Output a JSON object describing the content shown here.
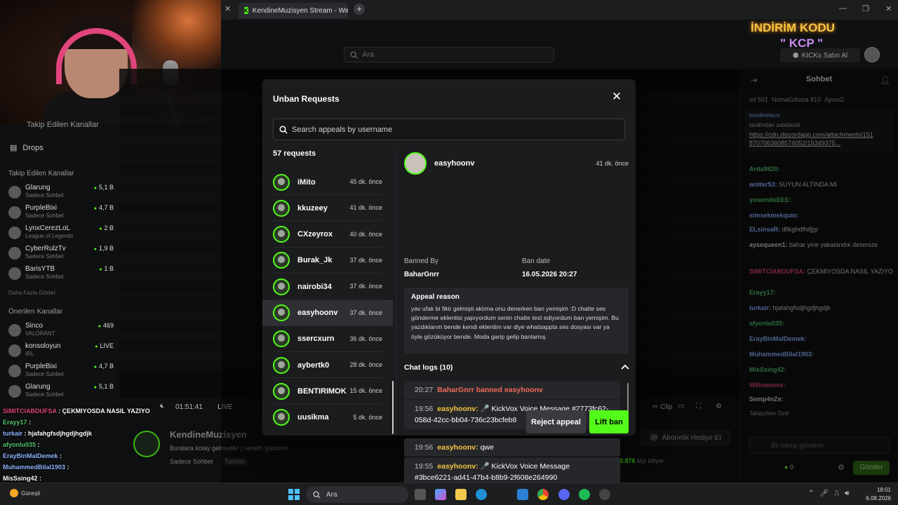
{
  "browser": {
    "tab_title": "KendineMuzisyen Stream - Wa",
    "tab_close": "✕",
    "new_tab": "+",
    "search_placeholder": "Ara"
  },
  "promo": {
    "line1": "İNDİRİM KODU",
    "line2": "\" KCP \"",
    "kicks_label": "KICKs Satın Al"
  },
  "left_sidebar": {
    "following_label": "Takip Edilen Kanallar",
    "drops_label": "Drops",
    "followed_header": "Takip Edilen Kanallar",
    "followed": [
      {
        "name": "Glarung",
        "sub": "Sadece Sohbet",
        "viewers": "5,1 B"
      },
      {
        "name": "PurpleBixi",
        "sub": "Sadece Sohbet",
        "viewers": "4,7 B"
      },
      {
        "name": "LynxCerezLoL",
        "sub": "League of Legends",
        "viewers": "2 B"
      },
      {
        "name": "CyberRulzTv",
        "sub": "Sadece Sohbet",
        "viewers": "1,9 B"
      },
      {
        "name": "BarisYTB",
        "sub": "Sadece Sohbet",
        "viewers": "1 B"
      }
    ],
    "show_more": "Daha Fazla Göster",
    "recommended_header": "Önerilen Kanallar",
    "recommended": [
      {
        "name": "Sinco",
        "sub": "VALORANT",
        "viewers": "469"
      },
      {
        "name": "konsoloyun",
        "sub": "IRL",
        "viewers": "LIVE"
      },
      {
        "name": "PurpleBixi",
        "sub": "Sadece Sohbet",
        "viewers": "4,7 B"
      },
      {
        "name": "Glarung",
        "sub": "Sadece Sohbet",
        "viewers": "5,1 B"
      }
    ]
  },
  "player": {
    "time": "01:51:41",
    "live": "LIVE",
    "clip": "Clip"
  },
  "stream_info": {
    "channel": "KendineMuzisyen",
    "desc": "Buralara kolay gelmedik! | !wraith !pindirim",
    "tags": [
      "Sadece Sohbet",
      "Turkish"
    ],
    "gift_label": "Abonelik Hediye Et",
    "viewers_count": "10.876",
    "viewers_label": "kişi izliyor"
  },
  "chat": {
    "title": "Sohbet",
    "top_gifters": [
      "ml 501",
      "NomaGdusia 810",
      "ApuuG"
    ],
    "pinned_by": "kendinetaco",
    "pinned_from": "tarafından sabitlendi",
    "pinned_link": "https://cdn.discordapp.com/attachments/1518707063608574052/15349375...",
    "messages": [
      {
        "user": "Arda9820:",
        "text": "",
        "color": "#53c56c"
      },
      {
        "user": "wolter53:",
        "text": "SUYUN ALTINDA MI",
        "color": "#8fb4ff"
      },
      {
        "user": "yosemiteEEE:",
        "text": "",
        "color": "#53c56c"
      },
      {
        "user": "simsekmekquin:",
        "text": "",
        "color": "#8fb4ff"
      },
      {
        "user": "ELsinsaR:",
        "text": "dfikghdfhifjjşi",
        "color": "#8fb4ff"
      },
      {
        "user": "aysequeen1:",
        "text": "bahar yine yakalandık desenize",
        "color": "#cfcfcf"
      },
      {
        "user": "SIMITCIABDUFSA:",
        "text": "ÇEKMIYOSDA NASIL YAZIYO",
        "color": "#e0457b"
      },
      {
        "user": "Erayy17:",
        "text": "",
        "color": "#53c56c"
      },
      {
        "user": "turkair:",
        "text": "hjafahgfsdjhgdjhgdjk",
        "color": "#8fb4ff"
      },
      {
        "user": "afyonlu035:",
        "text": "",
        "color": "#53c56c"
      },
      {
        "user": "ErayBinMalDemek:",
        "text": "",
        "color": "#8fb4ff"
      },
      {
        "user": "MuhammedBilal1903:",
        "text": "",
        "color": "#8fb4ff"
      },
      {
        "user": "MisSsing42:",
        "text": "",
        "color": "#53c56c"
      },
      {
        "user": "Willowaves:",
        "text": "",
        "color": "#e0457b"
      },
      {
        "user": "Semp4nZe:",
        "text": "",
        "color": "#cfcfcf"
      }
    ],
    "followers_label": "Takipçilere Özel",
    "input_placeholder": "Bir mesaj gönderin",
    "points": "0",
    "send": "Gönder"
  },
  "overlay_chat": [
    {
      "user": "SIMITCIABDUFSA",
      "text": ": ÇEKMIYOSDA NASIL YAZIYO",
      "color": "#e0457b"
    },
    {
      "user": "Erayy17",
      "text": ":",
      "color": "#53c56c"
    },
    {
      "user": "turkair",
      "text": ": hjafahgfsdjhgdjhgdjk",
      "color": "#8fb4ff"
    },
    {
      "user": "afyonlu035",
      "text": ":",
      "color": "#53c56c"
    },
    {
      "user": "ErayBinMalDemek",
      "text": ":",
      "color": "#8fb4ff"
    },
    {
      "user": "MuhammedBilal1903",
      "text": ":",
      "color": "#8fb4ff"
    },
    {
      "user": "MisSsing42",
      "text": ":",
      "color": "#ffffff"
    },
    {
      "user": "Willowaves",
      "text": ":",
      "color": "#e0457b"
    }
  ],
  "modal": {
    "title": "Unban Requests",
    "search_placeholder": "Search appeals by username",
    "count_label": "57 requests",
    "requests": [
      {
        "name": "iMito",
        "time": "45 dk. önce"
      },
      {
        "name": "kkuzeey",
        "time": "41 dk. önce"
      },
      {
        "name": "CXzeyrox",
        "time": "40 dk. önce"
      },
      {
        "name": "Burak_Jk",
        "time": "37 dk. önce"
      },
      {
        "name": "nairobi34",
        "time": "37 dk. önce"
      },
      {
        "name": "easyhoonv",
        "time": "37 dk. önce"
      },
      {
        "name": "ssercxurn",
        "time": "36 dk. önce"
      },
      {
        "name": "aybertk0",
        "time": "28 dk. önce"
      },
      {
        "name": "BENTIRIMOK",
        "time": "15 dk. önce"
      },
      {
        "name": "uusikma",
        "time": "5 dk. önce"
      }
    ],
    "selected_index": 5,
    "detail": {
      "username": "easyhoonv",
      "time": "41 dk. önce",
      "banned_by_label": "Banned By",
      "banned_by": "BaharGnrr",
      "ban_date_label": "Ban date",
      "ban_date": "16.05.2026 20:27",
      "appeal_label": "Appeal reason",
      "appeal_text": "yav ufak bi fikir gelmişti aklıma onu denerken ban yemişim :D chatte ses gönderme eklentisi yapıyordum senin chatte test ediyordum ban yemişim. Bu yazdıklarım bende kendi eklentim var diye whatsappta ses dosyası var ya öyle gözüküyor bende. Moda garip gelip banlamış",
      "logs_label": "Chat logs (10)",
      "logs": [
        {
          "time": "20:27",
          "user": "",
          "text": "BaharGnrr banned easyhoonv",
          "type": "ban"
        },
        {
          "time": "19:56",
          "user": "easyhoonv:",
          "text": "🎤 KickVox Voice Message #2773fc62-058d-42cc-bb04-736c23bcfeb8",
          "type": "msg"
        },
        {
          "time": "19:56",
          "user": "easyhoonv:",
          "text": "qwe",
          "type": "msg"
        },
        {
          "time": "19:55",
          "user": "easyhoonv:",
          "text": "🎤 KickVox Voice Message #3bce6221-ad41-47b4-b8b9-2f608e264990",
          "type": "msg"
        }
      ],
      "reject_label": "Reject appeal",
      "lift_label": "Lift ban"
    }
  },
  "taskbar": {
    "weather": "Güneşli",
    "search": "Ara",
    "time": "18:01",
    "date": "6.08.2026"
  }
}
